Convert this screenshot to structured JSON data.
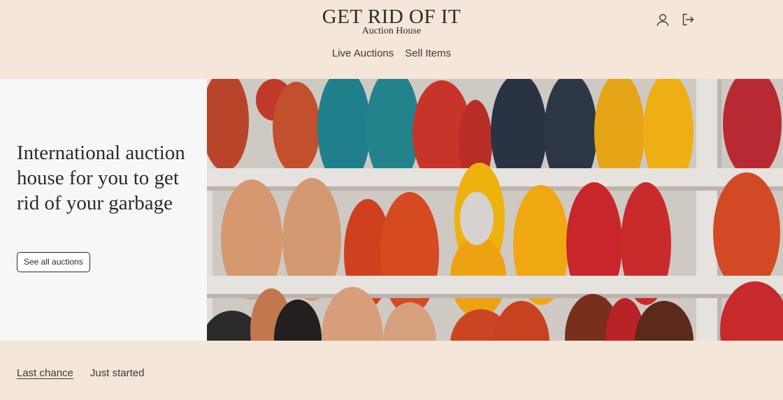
{
  "brand": {
    "title": "GET RID OF IT",
    "subtitle": "Auction House"
  },
  "nav": {
    "items": [
      {
        "label": "Live Auctions"
      },
      {
        "label": "Sell Items"
      }
    ]
  },
  "header_icons": [
    "user-icon",
    "logout-icon"
  ],
  "hero": {
    "heading": "International auction house for you to get rid of your garbage",
    "button_label": "See all auctions",
    "image_subject": "shelves of colorful leather slippers"
  },
  "tabs": {
    "items": [
      {
        "label": "Last chance",
        "active": true
      },
      {
        "label": "Just started",
        "active": false
      }
    ]
  },
  "colors": {
    "background": "#f4e6d8",
    "hero_panel": "#f8f7f7",
    "text": "#2b2b2b"
  }
}
